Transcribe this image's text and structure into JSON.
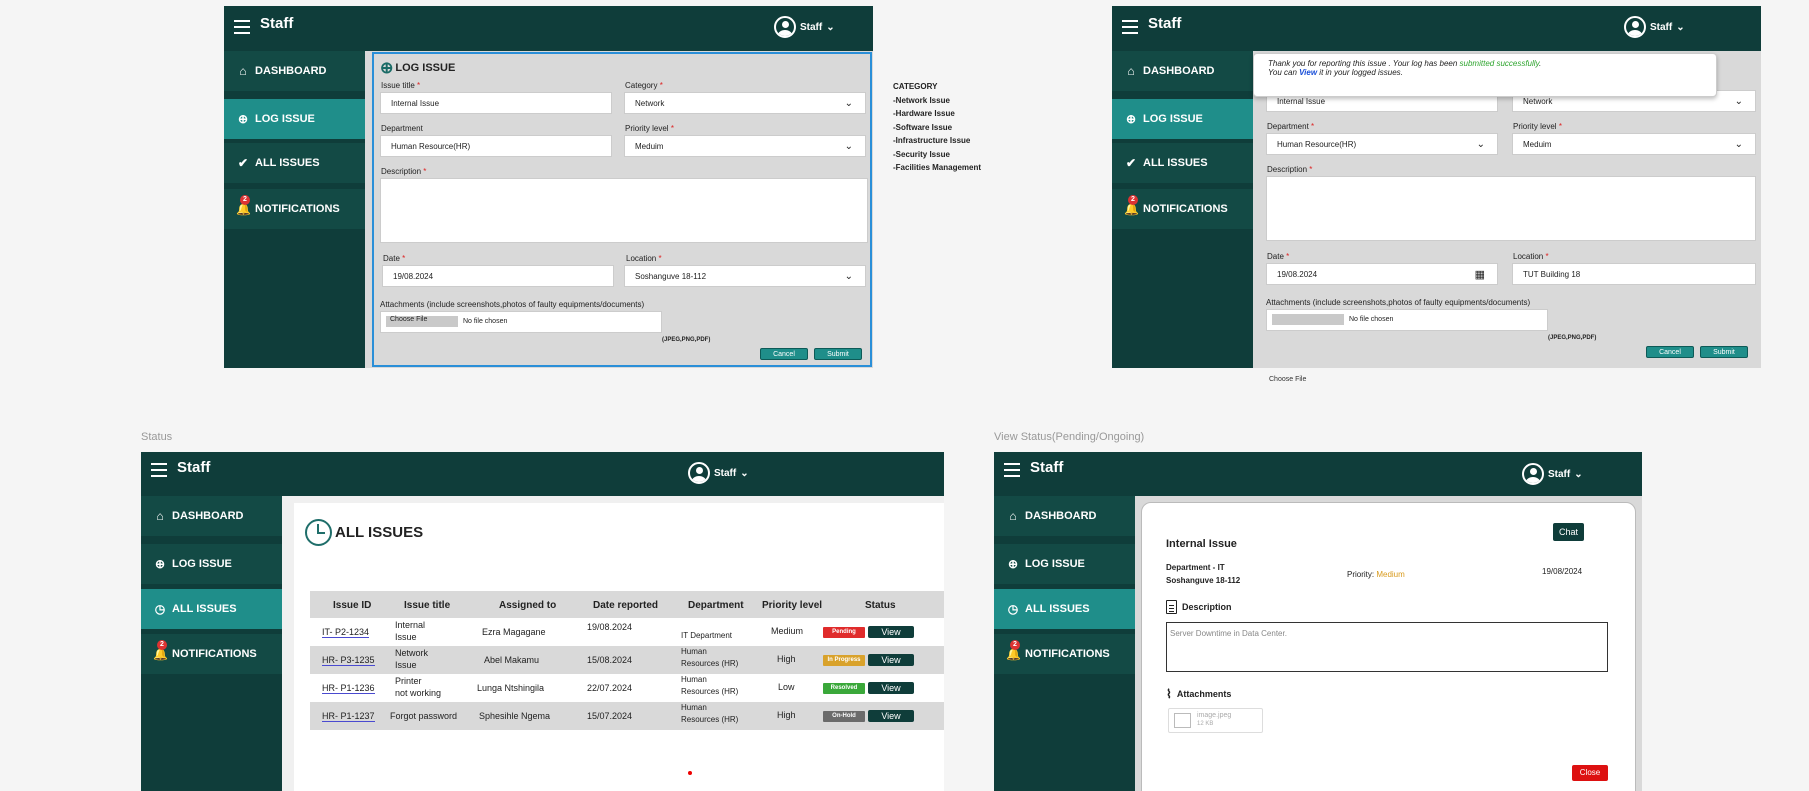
{
  "app": {
    "title": "Staff",
    "user_label": "Staff"
  },
  "nav": {
    "dashboard": "DASHBOARD",
    "log_issue": "LOG ISSUE",
    "all_issues": "ALL ISSUES",
    "notifications": "NOTIFICATIONS",
    "notif_count": "2"
  },
  "form": {
    "heading": "LOG ISSUE",
    "issue_title_label": "Issue title",
    "issue_title_value": "Internal Issue",
    "category_label": "Category",
    "category_value": "Network",
    "department_label": "Department",
    "department_value": "Human Resource(HR)",
    "priority_label": "Priority level",
    "priority_value": "Meduim",
    "description_label": "Description",
    "date_label": "Date",
    "date_value": "19/08.2024",
    "location_label": "Location",
    "location_value_1": "Soshanguve 18-112",
    "location_value_2": "TUT Building 18",
    "attachments_label": "Attachments (include screenshots,photos of faulty equipments/documents)",
    "choose_file": "Choose File",
    "no_file": "No file chosen",
    "file_types": "(JPEG,PNG,PDF)",
    "cancel": "Cancel",
    "submit": "Submit",
    "req": "*"
  },
  "category_note": {
    "heading": "CATEGORY",
    "items": [
      "-Network Issue",
      "-Hardware Issue",
      "-Software Issue",
      "-Infrastructure Issue",
      "-Security Issue",
      "-Facilities Management"
    ]
  },
  "success": {
    "line1_a": "Thank you for reporting this issue . Your log has been ",
    "line1_b": "submitted successfully",
    "line1_c": ".",
    "line2_a": "You can ",
    "line2_link": "View",
    "line2_b": " it in your logged issues."
  },
  "captions": {
    "status": "Status",
    "view_status": "View Status(Pending/Ongoing)",
    "choose_file_below": "Choose File"
  },
  "issues": {
    "heading": "ALL ISSUES",
    "columns": [
      "Issue ID",
      "Issue title",
      "Assigned to",
      "Date reported",
      "Department",
      "Priority level",
      "Status"
    ],
    "rows": [
      {
        "id": "IT- P2-1234",
        "title": [
          "Internal",
          "Issue"
        ],
        "assigned": "Ezra Magagane",
        "date": "19/08.2024",
        "dept": [
          "",
          "IT  Department"
        ],
        "priority": "Medium",
        "status": "Pending",
        "status_color": "#e02b2b",
        "view": "View"
      },
      {
        "id": "HR- P3-1235",
        "title": [
          "Network",
          "Issue"
        ],
        "assigned": "Abel Makamu",
        "date": "15/08.2024",
        "dept": [
          "Human",
          "Resources (HR)"
        ],
        "priority": "High",
        "status": "In Progress",
        "status_color": "#d9a22b",
        "view": "View"
      },
      {
        "id": "HR- P1-1236",
        "title": [
          "Printer",
          "not working"
        ],
        "assigned": "Lunga Ntshingila",
        "date": "22/07.2024",
        "dept": [
          "Human",
          "Resources (HR)"
        ],
        "priority": "Low",
        "status": "Resolved",
        "status_color": "#3aa83a",
        "view": "View"
      },
      {
        "id": "HR- P1-1237",
        "title": [
          "Forgot password",
          ""
        ],
        "assigned": "Sphesihle Ngema",
        "date": "15/07.2024",
        "dept": [
          "Human",
          "Resources (HR)"
        ],
        "priority": "High",
        "status": "On-Hold",
        "status_color": "#6b6b6b",
        "view": "View"
      }
    ]
  },
  "detail": {
    "chat": "Chat",
    "title": "Internal Issue",
    "department": "Department - IT",
    "location": "Soshanguve 18-112",
    "priority_label": "Priority: ",
    "priority_value": "Medium",
    "date": "19/08/2024",
    "description_heading": "Description",
    "description_text": "Server Downtime in Data Center.",
    "attachments_heading": "Attachments",
    "file_name": "image.jpeg",
    "file_size": "12 KB",
    "close": "Close"
  }
}
